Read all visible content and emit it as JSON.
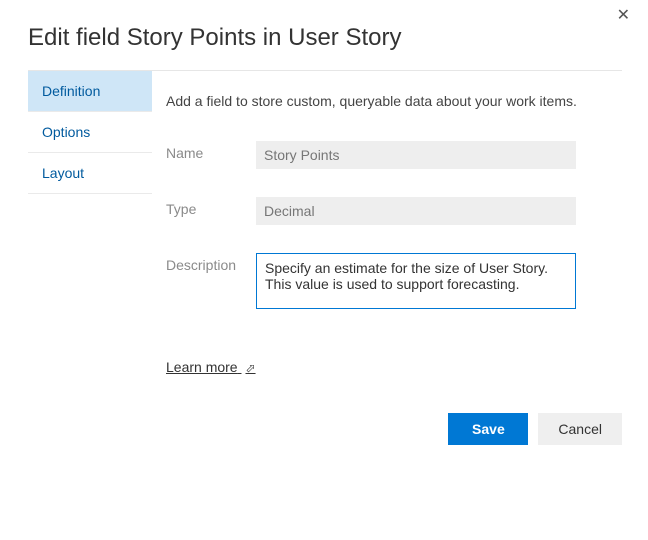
{
  "title": "Edit field Story Points in User Story",
  "sidebar": {
    "items": [
      {
        "label": "Definition"
      },
      {
        "label": "Options"
      },
      {
        "label": "Layout"
      }
    ]
  },
  "main": {
    "intro": "Add a field to store custom, queryable data about your work items.",
    "name_label": "Name",
    "name_value": "Story Points",
    "type_label": "Type",
    "type_value": "Decimal",
    "description_label": "Description",
    "description_value": "Specify an estimate for the size of User Story. This value is used to support forecasting.",
    "learn_more_label": "Learn more"
  },
  "footer": {
    "save_label": "Save",
    "cancel_label": "Cancel"
  }
}
